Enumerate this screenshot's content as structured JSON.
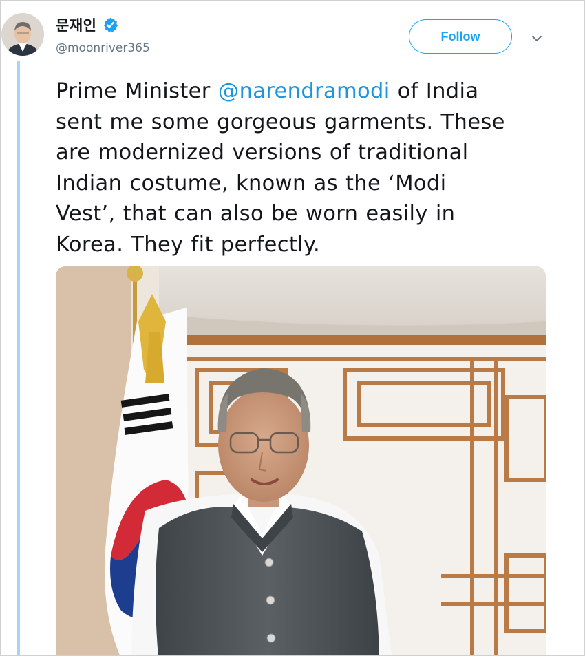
{
  "user": {
    "display_name": "문재인",
    "handle": "@moonriver365",
    "verified": true,
    "avatar_icon": "profile-photo"
  },
  "header": {
    "follow_label": "Follow",
    "caret_icon": "chevron-down-icon"
  },
  "tweet": {
    "line1_pre": "Prime Minister ",
    "mention": "@narendramodi",
    "line1_post": " of India",
    "line2": "sent me some gorgeous garments. These",
    "line3": "are modernized versions of traditional",
    "line4": "Indian costume, known as the ‘Modi",
    "line5": "Vest’, that can also be worn easily in",
    "line6": "Korea. They fit perfectly."
  },
  "colors": {
    "accent": "#1da1f2",
    "mention": "#1b95e0",
    "thread_line": "#a8d4f5",
    "muted": "#657786"
  }
}
